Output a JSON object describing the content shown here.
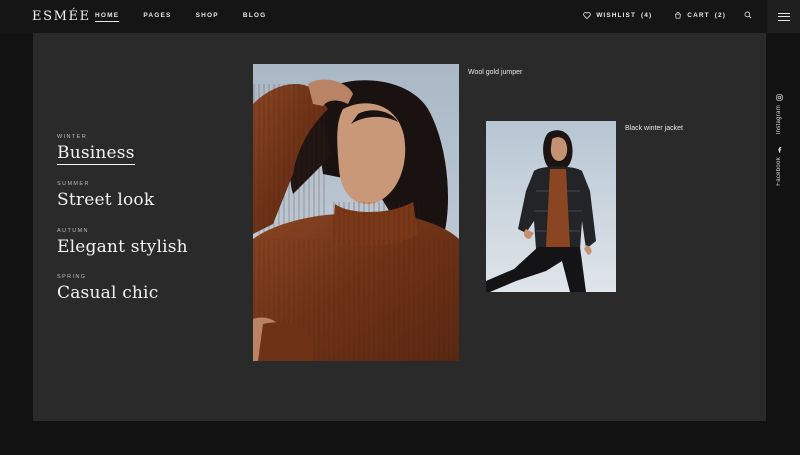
{
  "brand": {
    "logo": "ESMÉE"
  },
  "nav": {
    "items": [
      "HOME",
      "PAGES",
      "SHOP",
      "BLOG"
    ],
    "active": "HOME"
  },
  "tools": {
    "wishlist_label": "WISHLIST",
    "wishlist_count": "(4)",
    "cart_label": "CART",
    "cart_count": "(2)"
  },
  "collections": [
    {
      "season": "WINTER",
      "title": "Business",
      "active": true
    },
    {
      "season": "SUMMER",
      "title": "Street look",
      "active": false
    },
    {
      "season": "AUTUMN",
      "title": "Elegant stylish",
      "active": false
    },
    {
      "season": "SPRING",
      "title": "Casual chic",
      "active": false
    }
  ],
  "products": [
    {
      "name": "Wool gold jumper"
    },
    {
      "name": "Black winter jacket"
    }
  ],
  "social": [
    {
      "name": "Instagram",
      "icon": "instagram-icon"
    },
    {
      "name": "Facebook",
      "icon": "facebook-icon"
    }
  ],
  "colors": {
    "background": "#121212",
    "panel": "#2a2a2a",
    "header": "#151515",
    "sweater": "#7a3a1b",
    "sky": "#b7c6d3"
  }
}
